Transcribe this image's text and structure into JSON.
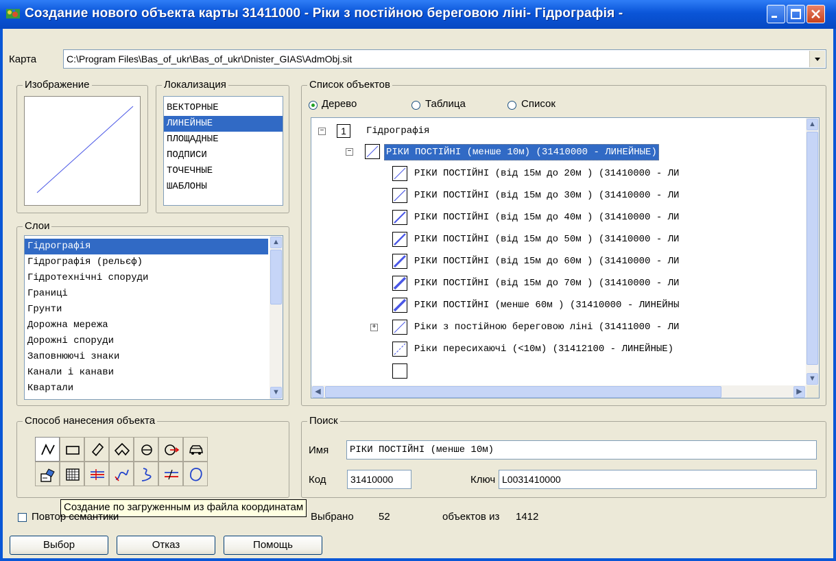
{
  "window": {
    "title": "Создание нового объекта карты 31411000 - Ріки з постійною береговою ліні- Гідрографія -"
  },
  "map": {
    "label": "Карта",
    "path": "C:\\Program Files\\Bas_of_ukr\\Bas_of_ukr\\Dnister_GIAS\\AdmObj.sit"
  },
  "image_group": {
    "title": "Изображение"
  },
  "localization": {
    "title": "Локализация",
    "items": [
      "ВЕКТОРНЫЕ",
      "ЛИНЕЙНЫЕ",
      "ПЛОЩАДНЫЕ",
      "ПОДПИСИ",
      "ТОЧЕЧНЫЕ",
      "ШАБЛОНЫ"
    ],
    "selected": "ЛИНЕЙНЫЕ"
  },
  "layers": {
    "title": "Слои",
    "items": [
      "Гідрографія",
      "Гідрографія (рельєф)",
      "Гідротехнічні споруди",
      "Границі",
      "Грунти",
      "Дорожна мережа",
      "Дорожні споруди",
      "Заповнюючі знаки",
      "Канали і канави",
      "Квартали"
    ],
    "selected": "Гідрографія"
  },
  "objects": {
    "title": "Список объектов",
    "view_modes": [
      "Дерево",
      "Таблица",
      "Список"
    ],
    "selected_mode": "Дерево",
    "tree": [
      {
        "expander": "−",
        "number": "1",
        "label": "Гідрографія"
      },
      {
        "expander": "−",
        "label": "РІКИ ПОСТІЙНІ (менше 10м) (31410000 - ЛИНЕЙНЫЕ)"
      },
      {
        "label": "РІКИ ПОСТІЙНІ (від 15м до 20м ) (31410000 - ЛИ"
      },
      {
        "label": "РІКИ ПОСТІЙНІ (від 15м до 30м ) (31410000 - ЛИ"
      },
      {
        "label": "РІКИ ПОСТІЙНІ (від 15м до 40м ) (31410000 - ЛИ"
      },
      {
        "label": "РІКИ ПОСТІЙНІ (від 15м до 50м ) (31410000 - ЛИ"
      },
      {
        "label": "РІКИ ПОСТІЙНІ (від 15м до 60м ) (31410000 - ЛИ"
      },
      {
        "label": "РІКИ ПОСТІЙНІ (від 15м до 70м ) (31410000 - ЛИ"
      },
      {
        "label": "РІКИ ПОСТІЙНІ (менше 60м ) (31410000 - ЛИНЕЙНЫ"
      },
      {
        "expander": "+",
        "label": "Ріки з постійною береговою ліні (31411000 - ЛИ"
      },
      {
        "label": "Ріки пересихаючі (<10м)  (31412100 - ЛИНЕЙНЫЕ)"
      }
    ]
  },
  "drawing_method": {
    "title": "Способ нанесения объекта",
    "tools": [
      "polyline-tool-icon",
      "rectangle-tool-icon",
      "rotated-rectangle-tool-icon",
      "polygon-tool-icon",
      "circle-tool-icon",
      "circle-arrow-tool-icon",
      "vehicle-tool-icon",
      "file-import-tool-icon",
      "grid-tool-icon",
      "line-crossing-tool-icon",
      "curve-arrow-tool-icon",
      "s-curve-tool-icon",
      "double-line-tool-icon",
      "loop-tool-icon"
    ],
    "tooltip": "Создание по загруженным из файла координатам"
  },
  "search": {
    "title": "Поиск",
    "name_label": "Имя",
    "name_value": "РІКИ ПОСТІЙНІ (менше 10м)",
    "code_label": "Код",
    "code_value": "31410000",
    "key_label": "Ключ",
    "key_value": "L0031410000"
  },
  "footer": {
    "repeat_semantics": "Повтор семантики",
    "selected_label": "Выбрано",
    "selected_count": "52",
    "of_label": "объектов из",
    "total_count": "1412",
    "buttons": {
      "select": "Выбор",
      "cancel": "Отказ",
      "help": "Помощь"
    }
  },
  "colors": {
    "title_bar": "#0a57d6",
    "selection": "#316ac5",
    "face": "#ece9d8"
  }
}
